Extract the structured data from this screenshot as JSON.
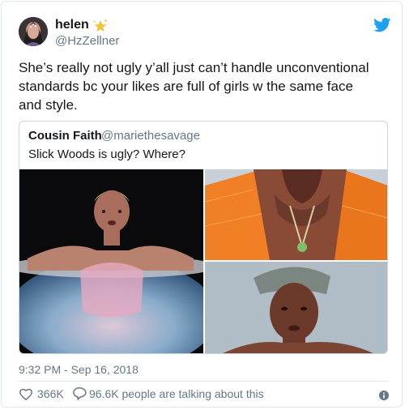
{
  "tweet": {
    "display_name": "helen",
    "handle": "@HzZellner",
    "text": "She’s really not ugly y’all just can’t handle unconventional standards bc your likes are full of girls w the same face and style.",
    "timestamp": "9:32 PM - Sep 16, 2018",
    "likes": "366K",
    "talking": "96.6K people are talking about this"
  },
  "quoted": {
    "display_name": "Cousin Faith",
    "handle": "@mariethesavage",
    "text": "Slick Woods is ugly? Where?"
  },
  "icons": {
    "bird": "twitter-bird-icon",
    "name_emoji": "star-emoji",
    "like": "heart-icon",
    "reply": "reply-bubble-icon",
    "info": "info-icon"
  },
  "colors": {
    "brand_blue": "#1da1f2",
    "secondary_text": "#657786",
    "border": "#e1e8ed"
  }
}
